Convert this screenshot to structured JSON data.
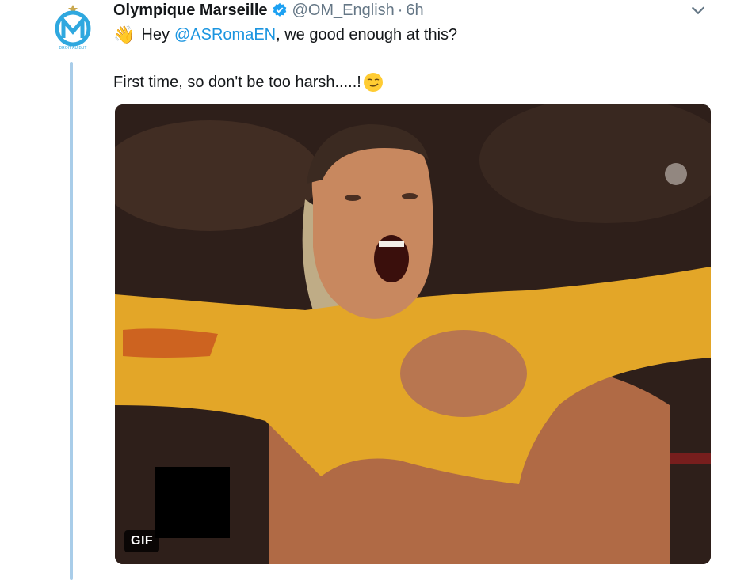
{
  "tweet": {
    "author_name": "Olympique Marseille",
    "handle": "@OM_English",
    "separator": "·",
    "time": "6h",
    "greeting_emoji": "👋",
    "text_prefix": "Hey ",
    "mention": "@ASRomaEN",
    "text_suffix": ", we good enough at this?",
    "second_line": "First time, so don't be too harsh.....!",
    "second_line_emoji_icon": "smirking-face-icon",
    "avatar_text": "DROIT AU BUT",
    "avatar_icon": "om-logo-icon",
    "verified_icon": "verified-badge-icon",
    "menu_icon": "chevron-down-icon"
  },
  "media": {
    "badge": "GIF",
    "type": "animated-gif"
  },
  "colors": {
    "accent": "#1b95e0",
    "muted": "#657786",
    "thread_line": "#a9cde9",
    "shirt_yellow": "#e3a628"
  }
}
